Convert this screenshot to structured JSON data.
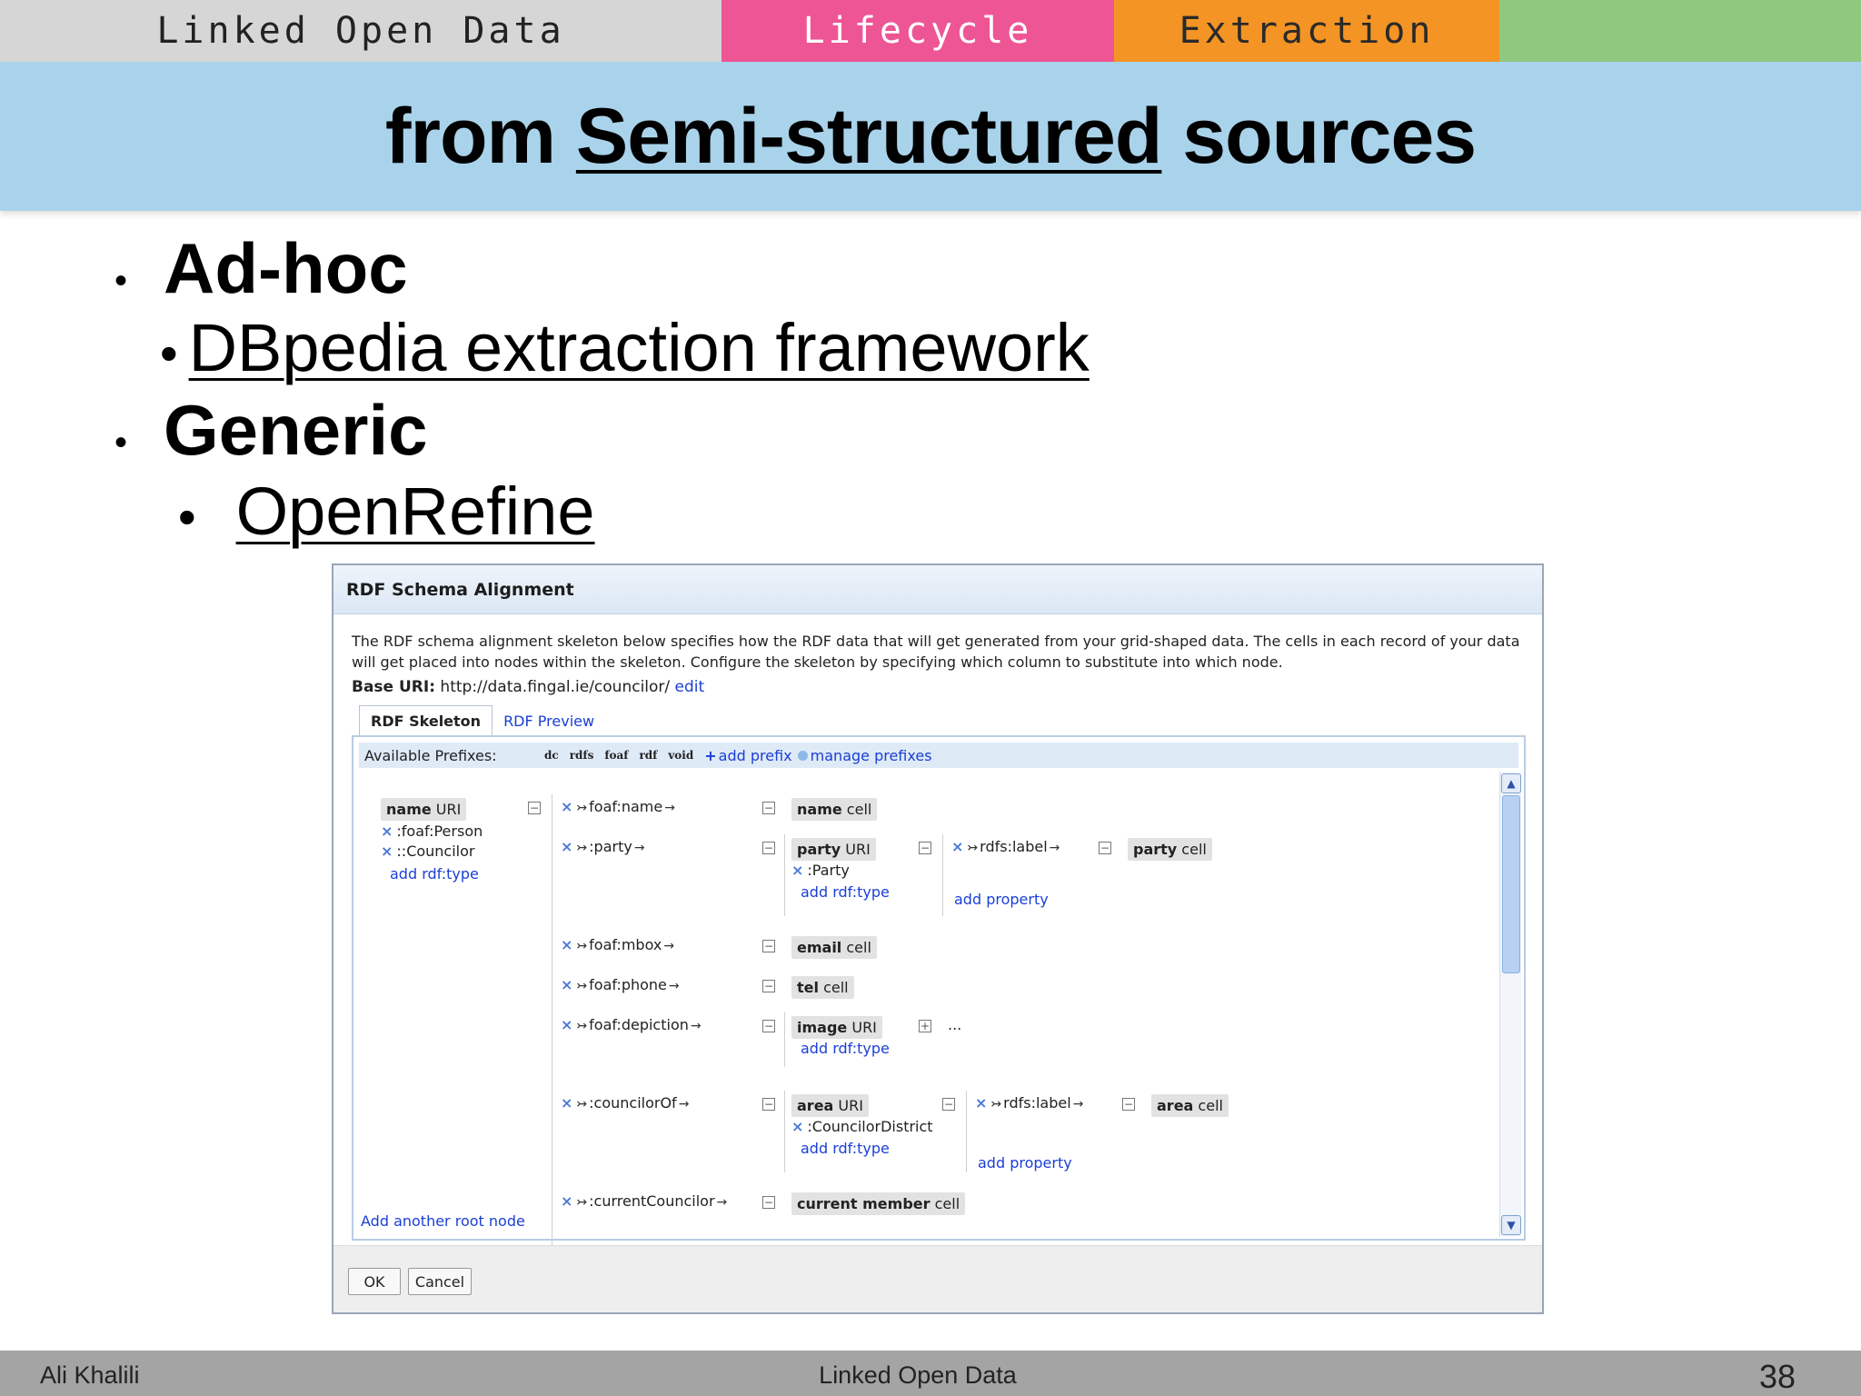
{
  "header": {
    "tabs": [
      "Linked Open Data",
      "Lifecycle",
      "Extraction",
      ""
    ],
    "title_pre": "from ",
    "title_emph": "Semi-structured",
    "title_post": " sources"
  },
  "bullets": {
    "dot_main": "•",
    "dot_sub": "•",
    "adhoc": "Ad-hoc",
    "dbpedia": "DBpedia extraction framework",
    "generic": "Generic",
    "openrefine": "OpenRefine"
  },
  "dialog": {
    "title": "RDF Schema Alignment",
    "description": "The RDF schema alignment skeleton below specifies how the RDF data that will get generated from your grid-shaped data. The cells in each record of your data will get placed into nodes within the skeleton. Configure the skeleton by specifying which column to substitute into which node.",
    "base_uri_label": "Base URI:",
    "base_uri_value": "http://data.fingal.ie/councilor/",
    "base_uri_edit": "edit",
    "tabs": [
      "RDF Skeleton",
      "RDF Preview"
    ],
    "prefixes_label": "Available Prefixes:",
    "prefixes": [
      "dc",
      "rdfs",
      "foaf",
      "rdf",
      "void"
    ],
    "add_prefix": "add prefix",
    "manage_prefixes": "manage prefixes",
    "root": {
      "node_bold": "name",
      "node_rest": " URI",
      "types": [
        ":foaf:Person",
        "::Councilor"
      ],
      "add_type": "add rdf:type"
    },
    "properties": [
      {
        "label": "foaf:name",
        "target_bold": "name",
        "target_rest": " cell"
      },
      {
        "label": ":party",
        "target_bold": "party",
        "target_rest": " URI",
        "type": ":Party",
        "add_type": "add rdf:type",
        "sub_label": "rdfs:label",
        "sub_target_bold": "party",
        "sub_target_rest": " cell",
        "add_property": "add property"
      },
      {
        "label": "foaf:mbox",
        "target_bold": "email",
        "target_rest": " cell"
      },
      {
        "label": "foaf:phone",
        "target_bold": "tel",
        "target_rest": " cell"
      },
      {
        "label": "foaf:depiction",
        "target_bold": "image",
        "target_rest": " URI",
        "add_type": "add rdf:type",
        "ellipsis": "..."
      },
      {
        "label": ":councilorOf",
        "target_bold": "area",
        "target_rest": " URI",
        "type": ":CouncilorDistrict",
        "add_type": "add rdf:type",
        "sub_label": "rdfs:label",
        "sub_target_bold": "area",
        "sub_target_rest": " cell",
        "add_property": "add property"
      },
      {
        "label": ":currentCouncilor",
        "target_bold": "current member",
        "target_rest": " cell"
      }
    ],
    "add_root": "Add another root node",
    "ok": "OK",
    "cancel": "Cancel"
  },
  "footer": {
    "author": "Ali Khalili",
    "course": "Linked Open Data",
    "page": "38"
  },
  "colors": {
    "tab_lod": "#d6d6d6",
    "tab_lifecycle": "#ee5595",
    "tab_extraction": "#f49424",
    "tab_green": "#90c880",
    "title_band": "#a9d3ea",
    "footer": "#a4a4a4",
    "link": "#1a3fd6"
  }
}
